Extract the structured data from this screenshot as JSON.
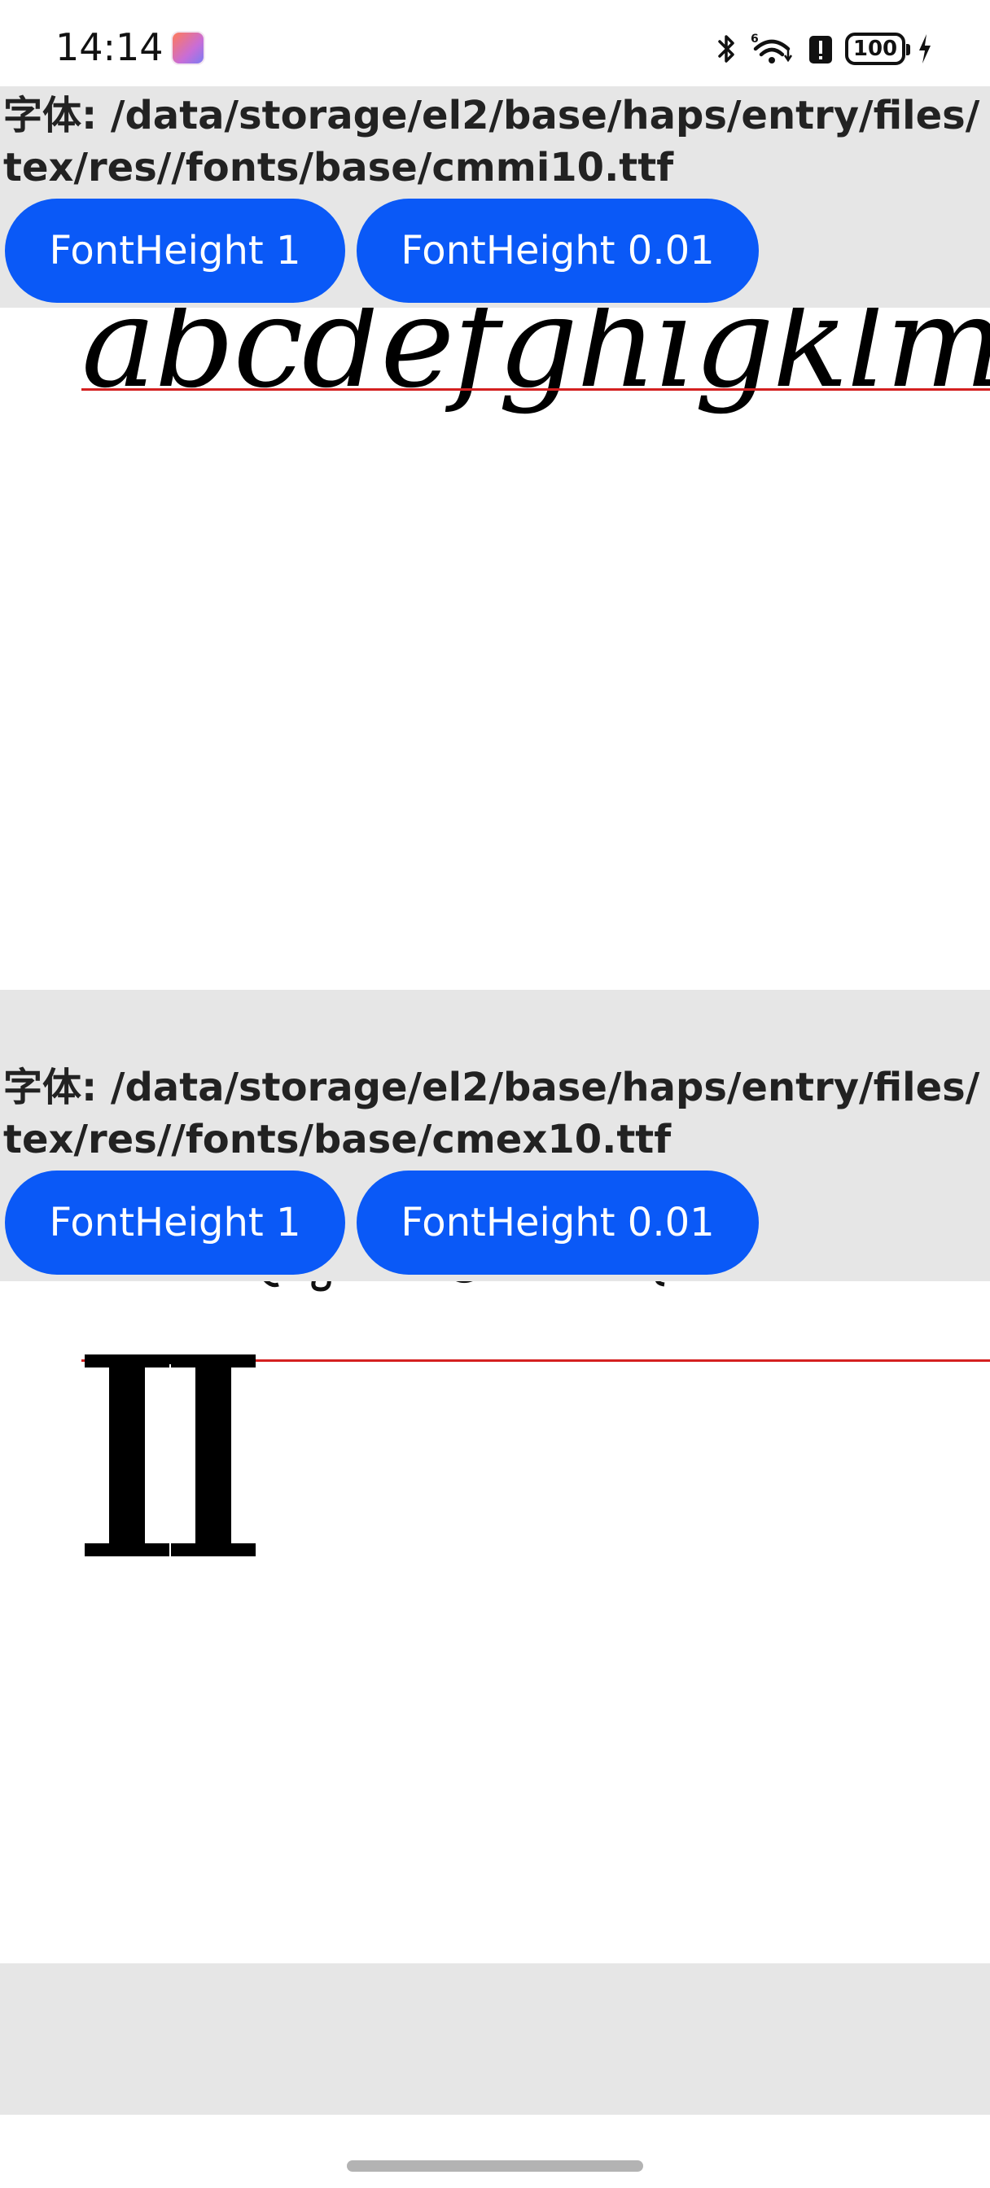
{
  "status_bar": {
    "time": "14:14",
    "battery": "100"
  },
  "sections": [
    {
      "font_label": "字体: /data/storage/el2/base/haps/entry/files/tex/res//fonts/base/cmmi10.ttf",
      "buttons": [
        "FontHeight 1",
        "FontHeight 0.01"
      ],
      "sample_text": "abcdefghigklmn"
    },
    {
      "font_label": "字体: /data/storage/el2/base/haps/entry/files/tex/res//fonts/base/cmex10.ttf",
      "buttons": [
        "FontHeight 1",
        "FontHeight 0.01"
      ],
      "sample_text": "II"
    }
  ],
  "colors": {
    "button_bg": "#0a59f7",
    "panel_bg": "#e6e6e6",
    "baseline": "#d42020"
  }
}
